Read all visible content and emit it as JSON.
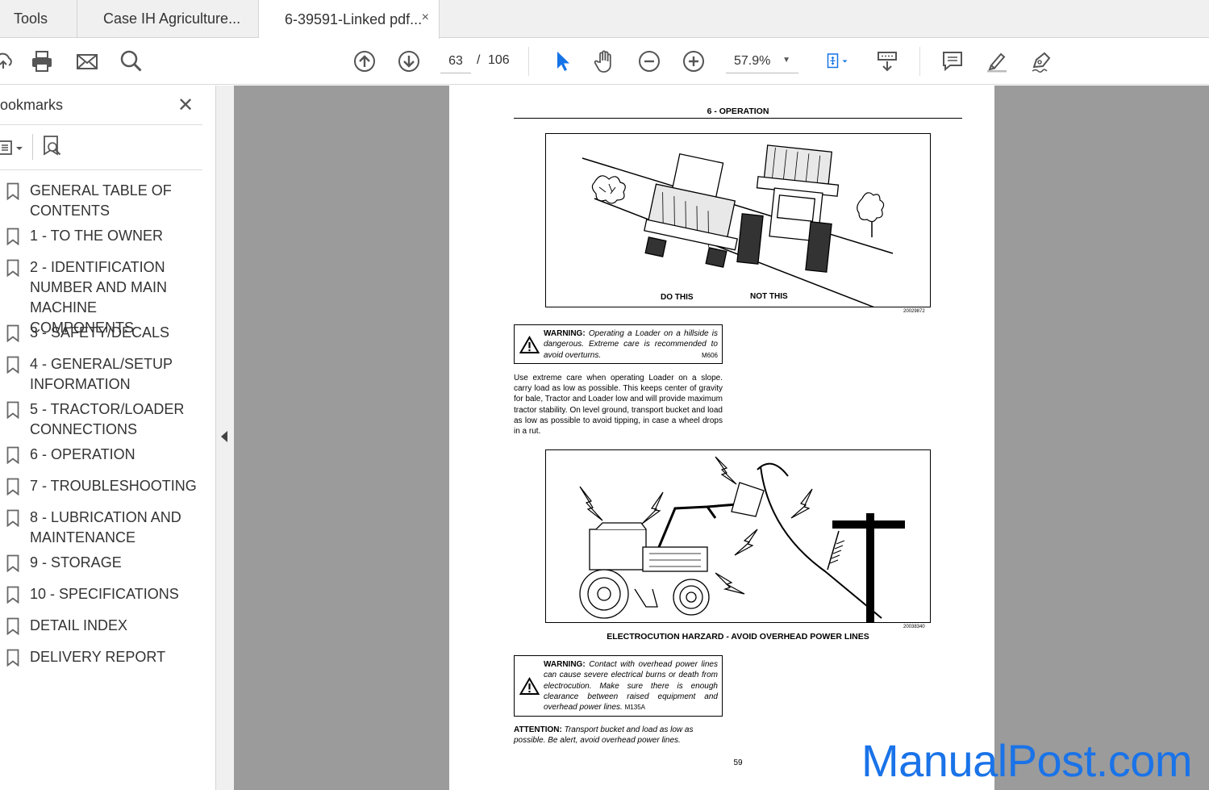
{
  "tabs": {
    "tools": "Tools",
    "tab1": "Case IH Agriculture...",
    "tab2": "6-39591-Linked pdf...",
    "close": "×"
  },
  "toolbar": {
    "page_current": "63",
    "page_sep": "/",
    "page_total": "106",
    "zoom": "57.9%"
  },
  "sidebar": {
    "title": "ookmarks",
    "close": "✕",
    "items": [
      {
        "label": "GENERAL TABLE OF CONTENTS"
      },
      {
        "label": "1 - TO THE OWNER"
      },
      {
        "label": "2 - IDENTIFICATION NUMBER AND MAIN MACHINE COMPONENTS"
      },
      {
        "label": "3 - SAFETY/DECALS"
      },
      {
        "label": "4 - GENERAL/SETUP INFORMATION"
      },
      {
        "label": "5 - TRACTOR/LOADER CONNECTIONS"
      },
      {
        "label": "6 - OPERATION"
      },
      {
        "label": "7 - TROUBLESHOOTING"
      },
      {
        "label": "8 - LUBRICATION AND MAINTENANCE"
      },
      {
        "label": "9 - STORAGE"
      },
      {
        "label": "10 - SPECIFICATIONS"
      },
      {
        "label": "DETAIL INDEX"
      },
      {
        "label": "DELIVERY REPORT"
      }
    ]
  },
  "document": {
    "header": "6 - OPERATION",
    "fig1": {
      "do_this": "DO THIS",
      "not_this": "NOT THIS",
      "code": "20029872"
    },
    "warning1": {
      "label": "WARNING:",
      "text": "Operating a Loader on a hillside is dangerous. Extreme care is recommended to avoid overturns.",
      "code": "M606"
    },
    "paragraph1": "Use extreme care when operating Loader on a slope. carry load as low as possible. This keeps center of gravity for bale, Tractor and Loader low and will provide maximum tractor stability. On level ground, transport bucket and load as low as possible to avoid tipping, in case a wheel drops in a rut.",
    "fig2": {
      "code": "20038340"
    },
    "fig2_caption": "ELECTROCUTION HARZARD - AVOID OVERHEAD POWER LINES",
    "warning2": {
      "label": "WARNING:",
      "text": "Contact with overhead power lines can cause severe electrical burns or death from electrocution. Make sure there is enough clearance between raised equipment and overhead power lines.",
      "code": "M135A"
    },
    "attention": {
      "label": "ATTENTION:",
      "text": "Transport bucket and load as low as possible. Be alert, avoid overhead power lines."
    },
    "page_number": "59"
  },
  "watermark": "ManualPost.com"
}
